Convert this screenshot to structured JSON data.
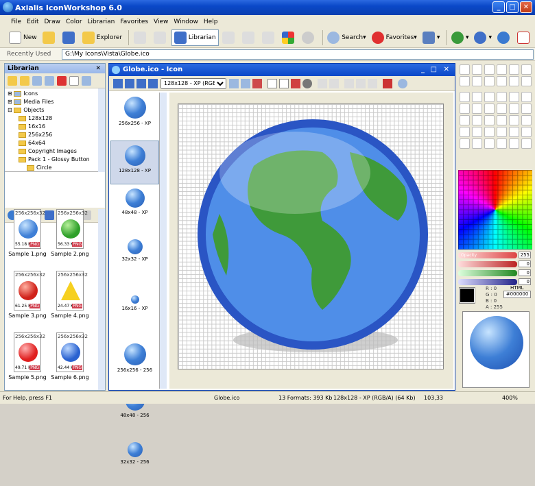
{
  "app": {
    "title": "Axialis IconWorkshop 6.0"
  },
  "menu": [
    "File",
    "Edit",
    "Draw",
    "Color",
    "Librarian",
    "Favorites",
    "View",
    "Window",
    "Help"
  ],
  "toolbar": {
    "new_label": "New",
    "explorer_label": "Explorer",
    "librarian_label": "Librarian",
    "search_label": "Search",
    "favorites_label": "Favorites"
  },
  "address": {
    "label": "Recently Used",
    "path": "G:\\My Icons\\Vista\\Globe.ico"
  },
  "librarian": {
    "title": "Librarian",
    "tree": [
      "Icons",
      "Media Files",
      "Objects",
      "128x128",
      "16x16",
      "256x256",
      "64x64",
      "Copyright Images",
      "Pack 1 - Glossy Button",
      "Circle"
    ],
    "items": [
      {
        "size": "256x256x32",
        "kb": "55.18 Kb",
        "fmt": "PNG",
        "name": "Sample 1.png"
      },
      {
        "size": "256x256x32",
        "kb": "56.33 Kb",
        "fmt": "PNG",
        "name": "Sample 2.png"
      },
      {
        "size": "256x256x32",
        "kb": "61.25 Kb",
        "fmt": "PNG",
        "name": "Sample 3.png"
      },
      {
        "size": "256x256x32",
        "kb": "24.47 Kb",
        "fmt": "PNG",
        "name": "Sample 4.png"
      },
      {
        "size": "256x256x32",
        "kb": "49.71 Kb",
        "fmt": "PNG",
        "name": "Sample 5.png"
      },
      {
        "size": "256x256x32",
        "kb": "42.44 Kb",
        "fmt": "PNG",
        "name": "Sample 6.png"
      }
    ]
  },
  "document": {
    "title": "Globe.ico - Icon",
    "format_select": "128x128 - XP (RGB/A)",
    "formats": [
      "256x256 - XP",
      "128x128 - XP",
      "48x48 - XP",
      "32x32 - XP",
      "16x16 - XP",
      "256x256 - 256",
      "48x48 - 256",
      "32x32 - 256"
    ]
  },
  "colorpanel": {
    "opacity_label": "Opacity",
    "opacity": "255",
    "v1": "0",
    "v2": "0",
    "v3": "0",
    "r": "R : 0",
    "g": "G : 0",
    "b": "B : 0",
    "a": "A : 255",
    "html_label": "HTML",
    "html": "#000000"
  },
  "status": {
    "help": "For Help, press F1",
    "file": "Globe.ico",
    "formats": "13 Formats: 393 Kb",
    "format": "128x128 - XP (RGB/A) (64 Kb)",
    "coords": "103,33",
    "zoom": "400%"
  }
}
